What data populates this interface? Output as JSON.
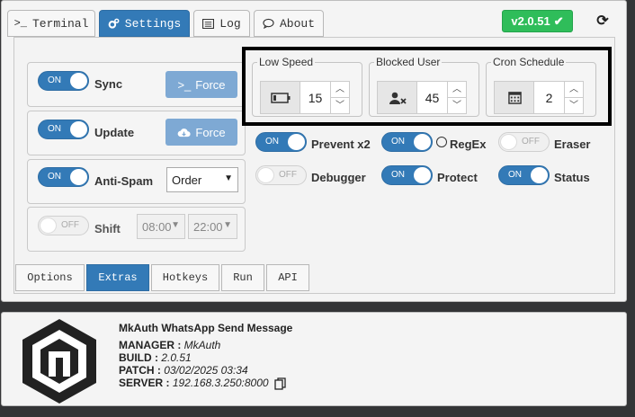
{
  "top_tabs": [
    {
      "label": "Terminal",
      "icon": ">_"
    },
    {
      "label": "Settings",
      "icon": "cogs"
    },
    {
      "label": "Log",
      "icon": "list"
    },
    {
      "label": "About",
      "icon": "comment"
    }
  ],
  "version": "v2.0.51",
  "left_rows": {
    "sync": {
      "toggle": "ON",
      "label": "Sync",
      "button": "Force"
    },
    "update": {
      "toggle": "ON",
      "label": "Update",
      "button": "Force"
    },
    "antispam": {
      "toggle": "ON",
      "label": "Anti-Spam",
      "select": "Order"
    },
    "shift": {
      "toggle": "OFF",
      "label": "Shift",
      "start": "08:00",
      "end": "22:00"
    }
  },
  "number_fields": [
    {
      "legend": "Low Speed",
      "value": "15",
      "icon": "battery-icon"
    },
    {
      "legend": "Blocked User",
      "value": "45",
      "icon": "user-block-icon"
    },
    {
      "legend": "Cron Schedule",
      "value": "2",
      "icon": "calendar-icon"
    }
  ],
  "toggles": [
    {
      "state": "ON",
      "label": "Prevent x2"
    },
    {
      "state": "ON",
      "label": "RegEx"
    },
    {
      "state": "OFF",
      "label": "Eraser"
    },
    {
      "state": "OFF",
      "label": "Debugger"
    },
    {
      "state": "ON",
      "label": "Protect"
    },
    {
      "state": "ON",
      "label": "Status"
    }
  ],
  "bottom_tabs": [
    "Options",
    "Extras",
    "Hotkeys",
    "Run",
    "API"
  ],
  "info": {
    "title": "MkAuth WhatsApp Send Message",
    "manager_label": "MANAGER :",
    "manager": "MkAuth",
    "build_label": "BUILD :",
    "build": "2.0.51",
    "patch_label": "PATCH :",
    "patch": "03/02/2025 03:34",
    "server_label": "SERVER :",
    "server": "192.168.3.250:8000"
  },
  "colors": {
    "accent": "#337ab7",
    "version_badge": "#2fbd5a",
    "background": "#333436"
  }
}
